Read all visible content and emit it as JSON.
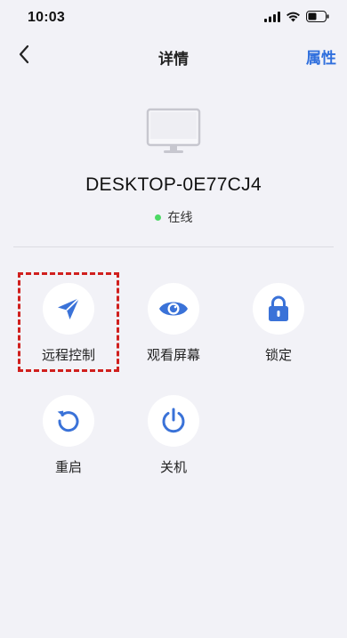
{
  "status_bar": {
    "time": "10:03",
    "icons": [
      "cellular-signal-icon",
      "wifi-icon",
      "battery-icon"
    ]
  },
  "nav": {
    "back_icon": "chevron-left-icon",
    "title": "详情",
    "right_action": "属性"
  },
  "device": {
    "icon": "monitor-icon",
    "name": "DESKTOP-0E77CJ4",
    "status": "在线",
    "status_color": "#4cd964"
  },
  "actions": [
    {
      "icon": "paper-plane-icon",
      "label": "远程控制",
      "highlighted": true
    },
    {
      "icon": "eye-icon",
      "label": "观看屏幕",
      "highlighted": false
    },
    {
      "icon": "lock-icon",
      "label": "锁定",
      "highlighted": false
    },
    {
      "icon": "restart-icon",
      "label": "重启",
      "highlighted": false
    },
    {
      "icon": "power-icon",
      "label": "关机",
      "highlighted": false
    }
  ],
  "colors": {
    "accent": "#2f6fdd",
    "icon_blue": "#3a72d8",
    "background": "#f2f2f7",
    "highlight_border": "#d0201e"
  }
}
